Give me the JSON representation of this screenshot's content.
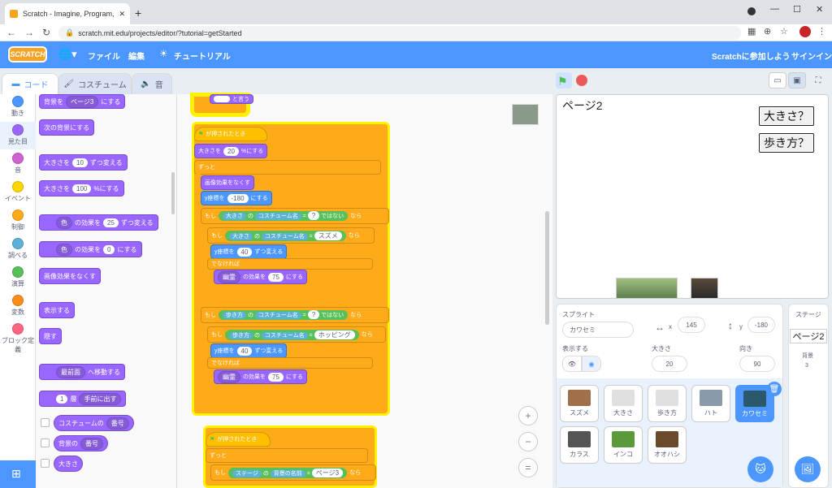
{
  "browser": {
    "tab_title": "Scratch - Imagine, Program, Sha",
    "url": "scratch.mit.edu/projects/editor/?tutorial=getStarted"
  },
  "menubar": {
    "logo": "SCRATCH",
    "file": "ファイル",
    "edit": "編集",
    "tutorials": "チュートリアル",
    "join": "Scratchに参加しよう",
    "signin": "サインイン"
  },
  "editor_tabs": {
    "code": "コード",
    "costumes": "コスチューム",
    "sounds": "音"
  },
  "categories": [
    {
      "label": "動き",
      "color": "#4c97ff"
    },
    {
      "label": "見た目",
      "color": "#9966ff"
    },
    {
      "label": "音",
      "color": "#cf63cf"
    },
    {
      "label": "イベント",
      "color": "#ffd500"
    },
    {
      "label": "制御",
      "color": "#ffab19"
    },
    {
      "label": "調べる",
      "color": "#5cb1d6"
    },
    {
      "label": "演算",
      "color": "#59c059"
    },
    {
      "label": "変数",
      "color": "#ff8c1a"
    },
    {
      "label": "ブロック定義",
      "color": "#ff6680"
    }
  ],
  "palette": {
    "switch_backdrop": "背景を",
    "backdrop_value": "ページ3",
    "switch_backdrop_tail": "にする",
    "next_backdrop": "次の背景にする",
    "change_size": "大きさを",
    "change_size_val": "10",
    "change_size_tail": "ずつ変える",
    "set_size": "大きさを",
    "set_size_val": "100",
    "set_size_tail": "%にする",
    "effect_dd": "色",
    "change_effect_mid": "の効果を",
    "change_effect_val": "25",
    "change_effect_tail": "ずつ変える",
    "set_effect_val": "0",
    "set_effect_tail": "にする",
    "clear_effects": "画像効果をなくす",
    "show": "表示する",
    "hide": "隠す",
    "front_dd": "最前面",
    "front_tail": "へ移動する",
    "layer_val": "1",
    "layer_mid": "層",
    "layer_dd": "手前に出す",
    "costume_rep": "コスチュームの",
    "costume_rep_dd": "番号",
    "backdrop_rep": "背景の",
    "backdrop_rep_dd": "番号",
    "size_rep": "大きさ"
  },
  "script": {
    "top_fragment": "と言う",
    "when_flag": "が押されたとき",
    "set_size": "大きさを",
    "set_size_val": "20",
    "set_size_tail": "%にする",
    "forever": "ずっと",
    "clear_effects": "画像効果をなくす",
    "set_y": "y座標を",
    "set_y_val": "-180",
    "set_y_tail": "にする",
    "if": "もし",
    "size_dd": "大きさ",
    "of": "の",
    "costume_name_dd": "コスチューム名",
    "eq": "=",
    "q": "?",
    "not": "ではない",
    "then": "なら",
    "sparrow": "スズメ",
    "change_y": "y座標を",
    "change_y_val": "40",
    "change_y_tail": "ずつ変える",
    "else": "でなければ",
    "ghost_dd": "幽霊",
    "effect_mid": "の効果を",
    "effect_val": "75",
    "effect_tail": "にする",
    "walk_dd": "歩き方",
    "hopping": "ホッピング",
    "stage_dd": "ステージ",
    "backdrop_name_dd": "背景の名前",
    "page3": "ページ3"
  },
  "stage": {
    "title": "ページ2",
    "btn_size": "大きさ？",
    "btn_walk": "歩き方？"
  },
  "sprite_info": {
    "heading": "スプライト",
    "name": "カワセミ",
    "x_label": "x",
    "x_val": "145",
    "y_label": "y",
    "y_val": "-180",
    "show_label": "表示する",
    "size_label": "大きさ",
    "size_val": "20",
    "dir_label": "向き",
    "dir_val": "90"
  },
  "sprites": [
    {
      "name": "スズメ",
      "color": "#a0704a",
      "selected": false
    },
    {
      "name": "大きさ",
      "color": "#e0e0e0",
      "selected": false
    },
    {
      "name": "歩き方",
      "color": "#e0e0e0",
      "selected": false
    },
    {
      "name": "ハト",
      "color": "#8899aa",
      "selected": false
    },
    {
      "name": "カワセミ",
      "color": "#2a5a6a",
      "selected": true
    },
    {
      "name": "カラス",
      "color": "#555",
      "selected": false
    },
    {
      "name": "インコ",
      "color": "#5a9a3a",
      "selected": false
    },
    {
      "name": "オオハシ",
      "color": "#6a4a2a",
      "selected": false
    }
  ],
  "stage_panel": {
    "heading": "ステージ",
    "backdrop_name": "ページ2",
    "backdrops_label": "背景",
    "backdrops_count": "3"
  }
}
